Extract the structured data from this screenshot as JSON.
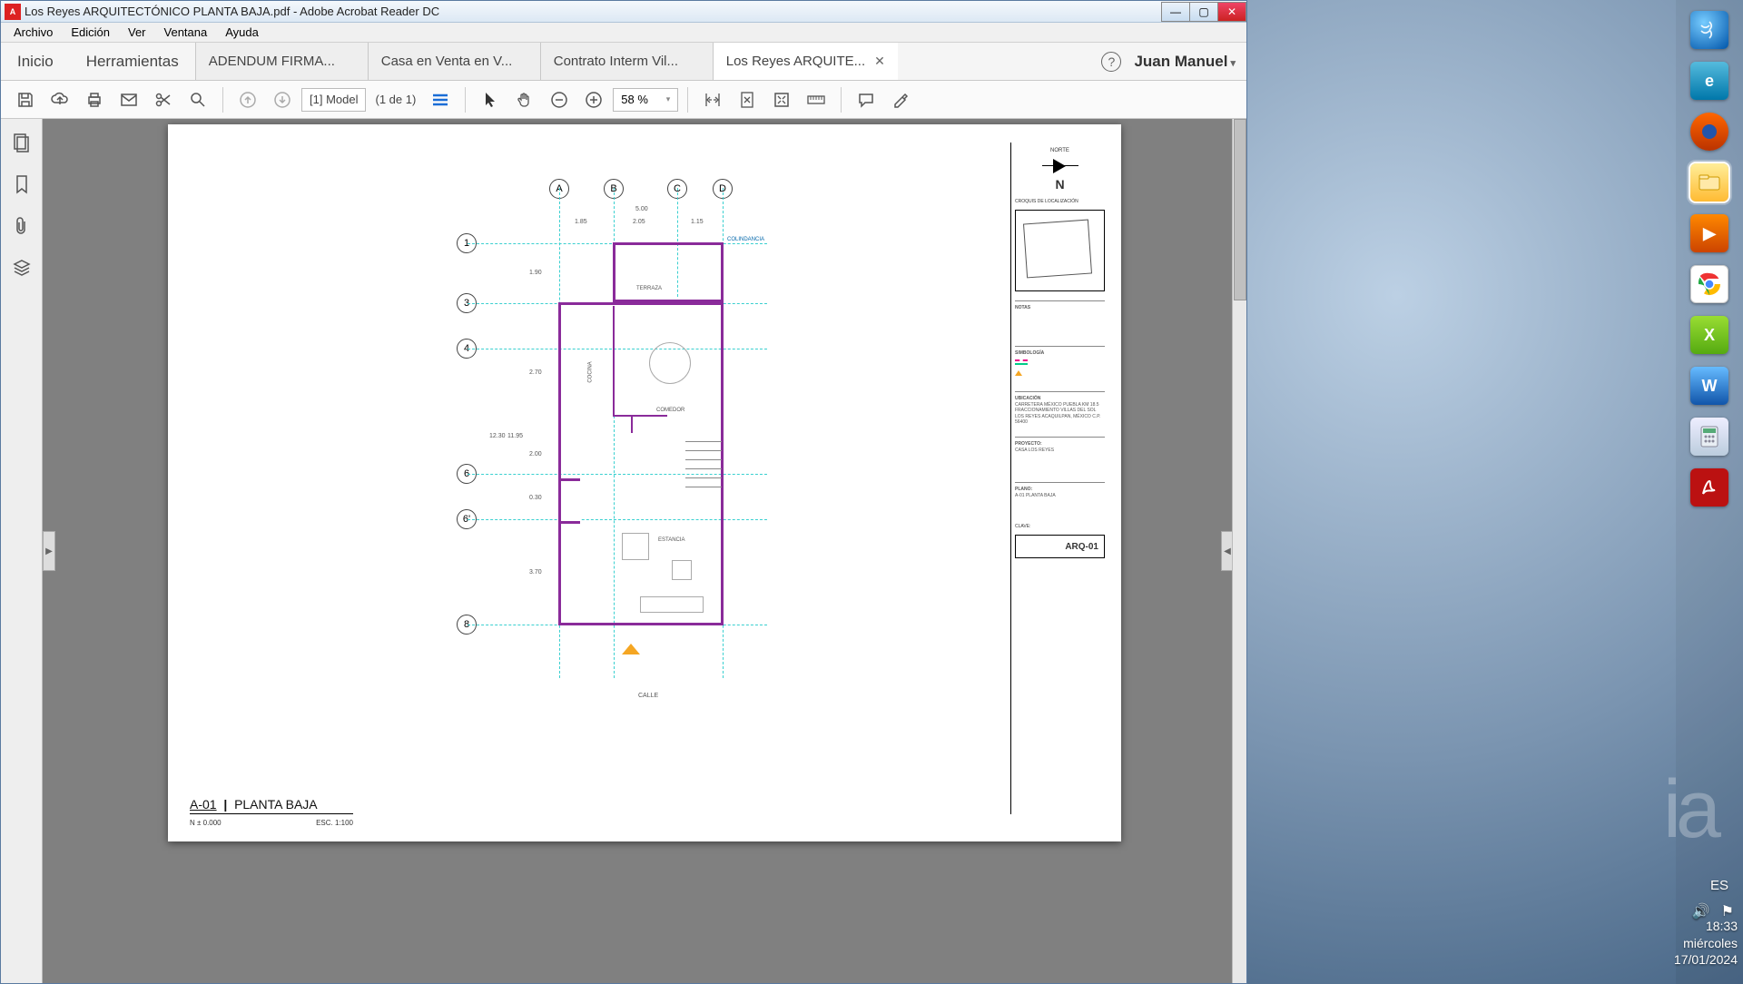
{
  "window": {
    "title": "Los Reyes ARQUITECTÓNICO PLANTA BAJA.pdf - Adobe Acrobat Reader DC"
  },
  "menu": {
    "archivo": "Archivo",
    "edicion": "Edición",
    "ver": "Ver",
    "ventana": "Ventana",
    "ayuda": "Ayuda"
  },
  "top": {
    "inicio": "Inicio",
    "herramientas": "Herramientas",
    "tabs": [
      {
        "label": "ADENDUM FIRMA..."
      },
      {
        "label": "Casa en Venta en V..."
      },
      {
        "label": "Contrato Interm Vil..."
      },
      {
        "label": "Los Reyes ARQUITE...",
        "active": true
      }
    ],
    "user": "Juan Manuel"
  },
  "toolbar": {
    "model": "[1] Model",
    "page_of": "(1 de 1)",
    "zoom": "58 %"
  },
  "sheet": {
    "plan_id": "A-01",
    "plan_name": "PLANTA BAJA",
    "n_level": "N ± 0.000",
    "esc": "ESC. 1:100",
    "north_label": "NORTE",
    "north_letter": "N",
    "loc_label": "CROQUIS DE LOCALIZACIÓN",
    "notas_label": "NOTAS",
    "simb_label": "SIMBOLOGÍA",
    "ubic_label": "UBICACIÓN",
    "ubic_text": "CARRETERA MÉXICO PUEBLA KM 18.5 FRACCIONAMIENTO VILLAS DEL SOL LOS REYES ACAQUILPAN, MÉXICO C.P. 56400",
    "proj_label": "PROYECTO:",
    "proj_text": "CASA LOS REYES",
    "plano_label": "PLANO:",
    "plano_text": "A-01 PLANTA BAJA",
    "clave_label": "CLAVE:",
    "clave": "ARQ-01",
    "calle": "CALLE"
  },
  "plan": {
    "letters": [
      "A",
      "B",
      "C",
      "D"
    ],
    "numbers": [
      "1",
      "3",
      "4",
      "6",
      "6'",
      "8"
    ],
    "rooms": {
      "terraza": "TERRAZA",
      "cocina": "COCINA",
      "comedor": "COMEDOR",
      "estancia": "ESTANCIA"
    },
    "dims_top": {
      "total": "5.00",
      "a": "1.85",
      "b": "2.05",
      "c": "1.15"
    },
    "dims_left": {
      "total": "12.30",
      "inner": "11.95",
      "d1": "1.90",
      "d2": "2.70",
      "d3": "2.00",
      "d4": "0.30",
      "d5": "3.70"
    },
    "col": "COLINDANCIA"
  },
  "desktop": {
    "lang": "ES",
    "time": "18:33",
    "day": "miércoles",
    "date": "17/01/2024"
  }
}
